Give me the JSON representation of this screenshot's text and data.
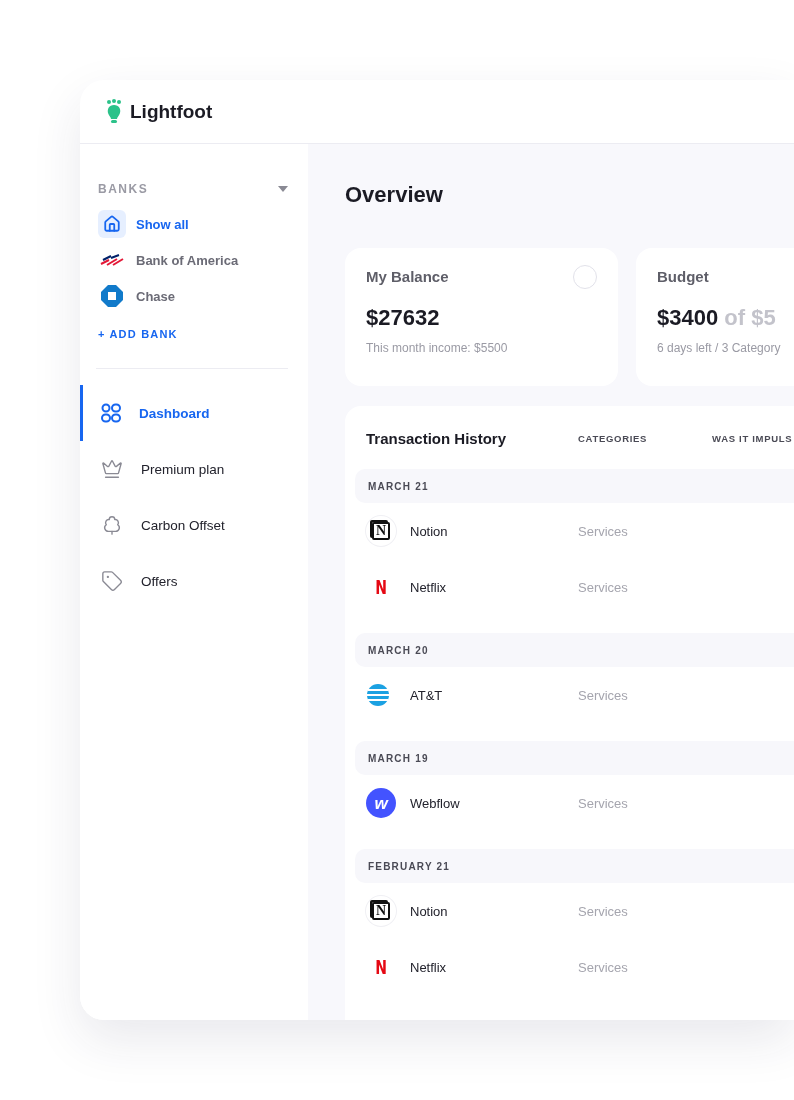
{
  "app": {
    "name": "Lightfoot"
  },
  "sidebar": {
    "banks_heading": "BANKS",
    "banks": [
      {
        "kind": "home",
        "label": "Show all",
        "selected": true
      },
      {
        "kind": "flag",
        "label": "Bank of America",
        "selected": false
      },
      {
        "kind": "octagon",
        "label": "Chase",
        "selected": false
      }
    ],
    "add_bank": "+ ADD BANK",
    "nav": [
      {
        "kind": "grid",
        "label": "Dashboard",
        "selected": true
      },
      {
        "kind": "crown",
        "label": "Premium plan",
        "selected": false
      },
      {
        "kind": "tree",
        "label": "Carbon Offset",
        "selected": false
      },
      {
        "kind": "tag",
        "label": "Offers",
        "selected": false
      }
    ]
  },
  "main": {
    "title": "Overview",
    "cards": [
      {
        "kind": "balance",
        "title": "My Balance",
        "amount": "$27632",
        "sub": "This month income: $5500"
      },
      {
        "kind": "budget",
        "title": "Budget",
        "amount": "$3400",
        "amount_suffix": "of $5",
        "sub": "6 days left / 3 Category"
      }
    ],
    "transactions": {
      "title": "Transaction History",
      "columns": [
        "CATEGORIES",
        "WAS IT IMPULS"
      ],
      "groups": [
        {
          "date": "MARCH 21",
          "items": [
            {
              "kind": "notion",
              "letter": "N",
              "name": "Notion",
              "category": "Services"
            },
            {
              "kind": "netflix",
              "letter": "N",
              "name": "Netflix",
              "category": "Services"
            }
          ]
        },
        {
          "date": "MARCH 20",
          "items": [
            {
              "kind": "globe",
              "name": "AT&T",
              "category": "Services"
            }
          ]
        },
        {
          "date": "MARCH 19",
          "items": [
            {
              "kind": "webflow",
              "letter": "w",
              "name": "Webflow",
              "category": "Services"
            }
          ]
        },
        {
          "date": "FEBRUARY 21",
          "items": [
            {
              "kind": "notion",
              "letter": "N",
              "name": "Notion",
              "category": "Services"
            },
            {
              "kind": "netflix",
              "letter": "N",
              "name": "Netflix",
              "category": "Services"
            }
          ]
        }
      ]
    }
  }
}
